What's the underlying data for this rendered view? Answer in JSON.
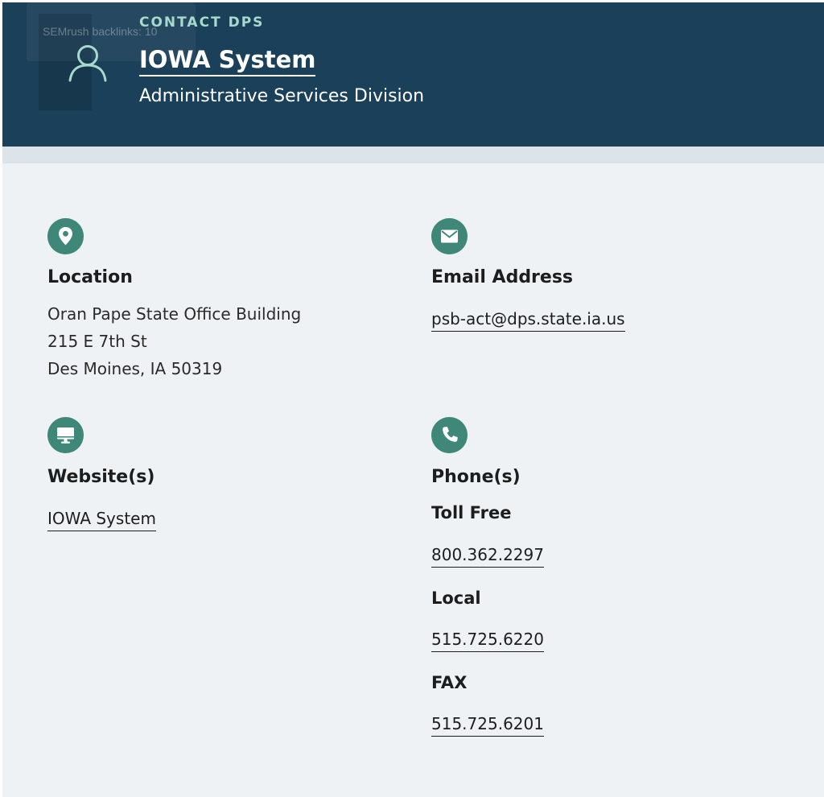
{
  "overlay": {
    "text": "SEMrush backlinks: 10"
  },
  "header": {
    "eyebrow": "CONTACT DPS",
    "title": "IOWA System",
    "subtitle": "Administrative Services Division"
  },
  "location": {
    "heading": "Location",
    "lines": [
      "Oran Pape State Office Building",
      "215 E 7th St",
      "Des Moines, IA 50319"
    ]
  },
  "email": {
    "heading": "Email Address",
    "address": "psb-act@dps.state.ia.us"
  },
  "website": {
    "heading": "Website(s)",
    "link": "IOWA System"
  },
  "phones": {
    "heading": "Phone(s)",
    "items": [
      {
        "label": "Toll Free",
        "number": "800.362.2297"
      },
      {
        "label": "Local",
        "number": "515.725.6220"
      },
      {
        "label": "FAX",
        "number": "515.725.6201"
      }
    ]
  },
  "colors": {
    "header": "#1b4059",
    "accent": "#3f8879",
    "eyebrow": "#a7d9cc",
    "page": "#eff2f4"
  }
}
